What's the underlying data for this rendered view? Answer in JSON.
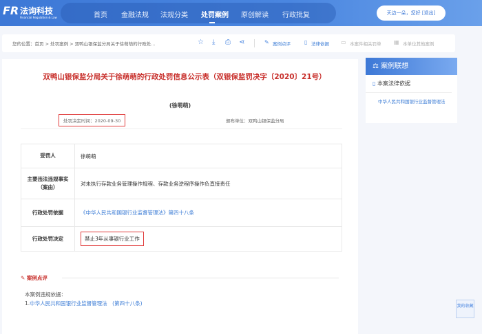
{
  "header": {
    "logo_mark": "FR",
    "logo_cn": "法询科技",
    "logo_en": "Financial Regulation & Law",
    "nav": [
      "首页",
      "金融法规",
      "法规分类",
      "处罚案例",
      "原创解读",
      "行政批复"
    ],
    "active_nav": 3,
    "user": "天边一朵，您好 [退出]"
  },
  "breadcrumb": "您的位置：首页 > 处罚案例 > 双鸭山银保监分局关于徐萌萌的行政处...",
  "toolbar": {
    "comment": "案例点评",
    "law": "法律依据",
    "related": "本案件相关罚单",
    "unit_cases": "本单位其他案例"
  },
  "doc": {
    "title": "双鸭山银保监分局关于徐萌萌的行政处罚信息公示表（双银保监罚决字〔2020〕21号）",
    "subtitle": "(徐萌萌)",
    "decision_time": "处罚决定时间：2020-09-30",
    "issuer": "颁布单位：双鸭山银保监分局",
    "rows": [
      {
        "label": "受罚人",
        "value": "徐萌萌"
      },
      {
        "label": "主要违法违规事实（案由）",
        "value": "对未执行存款业务管理操作规程、存款业务逆程序操作负直接责任"
      },
      {
        "label": "行政处罚依据",
        "value": "《中华人民共和国银行业监督管理法》第四十八条"
      },
      {
        "label": "行政处罚决定",
        "value": "禁止3年从事银行业工作"
      }
    ]
  },
  "comment": {
    "heading": "案例点评",
    "basis_label": "本案例违规依据：",
    "basis_num": "1.",
    "basis_link": "中华人民共和国银行业监督管理法　(第四十八条)"
  },
  "sidebar": {
    "title": "案例联想",
    "sub": "本案法律依据",
    "link": "中华人民共和国银行业监督管理法"
  },
  "fav": "我的收藏"
}
